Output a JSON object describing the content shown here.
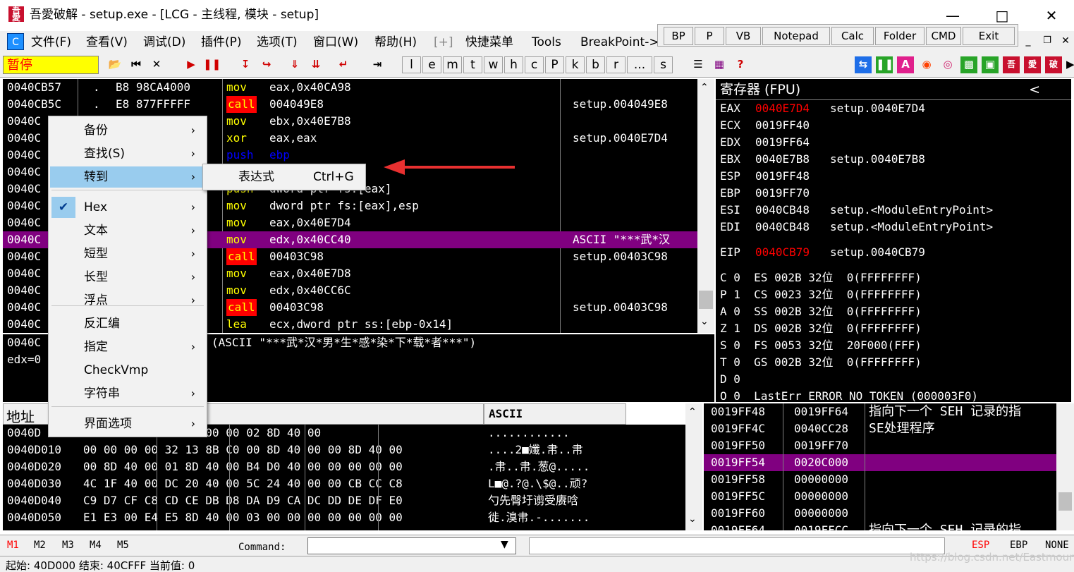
{
  "window": {
    "title": "吾愛破解 - setup.exe - [LCG -  主线程, 模块 - setup]",
    "icon_text": "吾愛"
  },
  "menu": [
    "文件(F)",
    "查看(V)",
    "调试(D)",
    "插件(P)",
    "选项(T)",
    "窗口(W)",
    "帮助(H)",
    "[+]",
    "快捷菜单",
    "Tools",
    "BreakPoint->"
  ],
  "quick_buttons": [
    "BP",
    "P",
    "VB",
    "Notepad",
    "Calc",
    "Folder",
    "CMD",
    "Exit"
  ],
  "toolbar": {
    "status": "暂停",
    "letters": [
      "l",
      "e",
      "m",
      "t",
      "w",
      "h",
      "c",
      "P",
      "k",
      "b",
      "r",
      "...",
      "s"
    ],
    "help": "?"
  },
  "disasm": {
    "rows": [
      {
        "addr": "0040CB57",
        "mark": ".",
        "hex": "B8 98CA4000",
        "mn": "mov",
        "ops": "eax,0x40CA98",
        "comment": ""
      },
      {
        "addr": "0040CB5C",
        "mark": ".",
        "hex": "E8 877FFFFF",
        "mn": "call",
        "ops": "004049E8",
        "comment": "setup.004049E8"
      },
      {
        "addr": "0040C",
        "mark": "",
        "hex": "",
        "mn": "mov",
        "ops": "ebx,0x40E7B8",
        "comment": ""
      },
      {
        "addr": "0040C",
        "mark": "",
        "hex": "",
        "mn": "xor",
        "ops": "eax,eax",
        "comment": "setup.0040E7D4"
      },
      {
        "addr": "0040C",
        "mark": "",
        "hex": "",
        "mn": "push",
        "ops": "ebp",
        "comment": ""
      },
      {
        "addr": "0040C",
        "mark": "",
        "hex": "",
        "mn": "",
        "ops": "",
        "comment": ""
      },
      {
        "addr": "0040C",
        "mark": "",
        "hex": "",
        "mn": "push",
        "ops": "dword ptr fs:[eax]",
        "comment": ""
      },
      {
        "addr": "0040C",
        "mark": "",
        "hex": "",
        "mn": "mov",
        "ops": "dword ptr fs:[eax],esp",
        "comment": ""
      },
      {
        "addr": "0040C",
        "mark": "",
        "hex": "",
        "mn": "mov",
        "ops": "eax,0x40E7D4",
        "comment": ""
      },
      {
        "addr": "0040C",
        "mark": "",
        "hex": "",
        "mn": "mov",
        "ops": "edx,0x40CC40",
        "comment": "ASCII \"***武*汉"
      },
      {
        "addr": "0040C",
        "mark": "",
        "hex": "",
        "mn": "call",
        "ops": "00403C98",
        "comment": "setup.00403C98"
      },
      {
        "addr": "0040C",
        "mark": "",
        "hex": "",
        "mn": "mov",
        "ops": "eax,0x40E7D8",
        "comment": ""
      },
      {
        "addr": "0040C",
        "mark": "",
        "hex": "",
        "mn": "mov",
        "ops": "edx,0x40CC6C",
        "comment": ""
      },
      {
        "addr": "0040C",
        "mark": "",
        "hex": "",
        "mn": "call",
        "ops": "00403C98",
        "comment": "setup.00403C98"
      },
      {
        "addr": "0040C",
        "mark": "",
        "hex": "",
        "mn": "lea",
        "ops": "ecx,dword ptr ss:[ebp-0x14]",
        "comment": ""
      }
    ],
    "info1": "0040C",
    "info2": "edx=0",
    "info_text": "(ASCII \"***武*汉*男*生*感*染*下*载*者***\")"
  },
  "registers": {
    "header": "寄存器 (FPU)",
    "collapse": "<",
    "rows": [
      {
        "name": "EAX",
        "val": "0040E7D4",
        "info": "setup.0040E7D4",
        "red": true
      },
      {
        "name": "ECX",
        "val": "0019FF40",
        "info": "",
        "red": false
      },
      {
        "name": "EDX",
        "val": "0019FF64",
        "info": "",
        "red": false
      },
      {
        "name": "EBX",
        "val": "0040E7B8",
        "info": "setup.0040E7B8",
        "red": false
      },
      {
        "name": "ESP",
        "val": "0019FF48",
        "info": "",
        "red": false
      },
      {
        "name": "EBP",
        "val": "0019FF70",
        "info": "",
        "red": false
      },
      {
        "name": "ESI",
        "val": "0040CB48",
        "info": "setup.<ModuleEntryPoint>",
        "red": false
      },
      {
        "name": "EDI",
        "val": "0040CB48",
        "info": "setup.<ModuleEntryPoint>",
        "red": false
      }
    ],
    "eip": {
      "name": "EIP",
      "val": "0040CB79",
      "info": "setup.0040CB79"
    },
    "flags": [
      "C 0  ES 002B 32位  0(FFFFFFFF)",
      "P 1  CS 0023 32位  0(FFFFFFFF)",
      "A 0  SS 002B 32位  0(FFFFFFFF)",
      "Z 1  DS 002B 32位  0(FFFFFFFF)",
      "S 0  FS 0053 32位  20F000(FFF)",
      "T 0  GS 002B 32位  0(FFFFFFFF)",
      "D 0",
      "O 0  LastErr ERROR_NO_TOKEN (000003F0)"
    ]
  },
  "dump": {
    "header_addr": "地址",
    "header_ascii": "ASCII",
    "rows": [
      {
        "addr": "0040D",
        "hex": "00 00 00 00 00 00 00 00 02 8D 40 00",
        "ascii": "............"
      },
      {
        "addr": "0040D010",
        "hex": "00 00 00 00 32 13 8B C0 00 8D 40 00 00 8D 40 00",
        "ascii": "....2■孅.帇..帇"
      },
      {
        "addr": "0040D020",
        "hex": "00 8D 40 00 01 8D 40 00 B4 D0 40 00 00 00 00 00",
        "ascii": ".帇..帇.葱@....."
      },
      {
        "addr": "0040D030",
        "hex": "4C 1F 40 00 DC 20 40 00 5C 24 40 00 00 CB CC C8",
        "ascii": "L■@.?@.\\$@..顽?"
      },
      {
        "addr": "0040D040",
        "hex": "C9 D7 CF C8 CD CE DB D8 DA D9 CA DC DD DE DF E0",
        "ascii": "勺先臀圩谫受赓唅"
      },
      {
        "addr": "0040D050",
        "hex": "E1 E3 00 E4 E5 8D 40 00 03 00 00 00 00 00 00 00",
        "ascii": "徙.溴帇.-......."
      }
    ]
  },
  "stack": {
    "rows": [
      {
        "addr": "0019FF48",
        "val": "0019FF64",
        "comment": "指向下一个 SEH 记录的指"
      },
      {
        "addr": "0019FF4C",
        "val": "0040CC28",
        "comment": "SE处理程序"
      },
      {
        "addr": "0019FF50",
        "val": "0019FF70",
        "comment": ""
      },
      {
        "addr": "0019FF54",
        "val": "0020C000",
        "comment": ""
      },
      {
        "addr": "0019FF58",
        "val": "00000000",
        "comment": ""
      },
      {
        "addr": "0019FF5C",
        "val": "00000000",
        "comment": ""
      },
      {
        "addr": "0019FF60",
        "val": "00000000",
        "comment": ""
      },
      {
        "addr": "0019FF64",
        "val": "0019FFCC",
        "comment": "指向下一个 SEH 记录的指"
      }
    ]
  },
  "context_menu": {
    "items": [
      {
        "label": "备份",
        "arrow": true,
        "checked": false
      },
      {
        "label": "查找(S)",
        "arrow": true,
        "checked": false
      },
      {
        "label": "转到",
        "arrow": true,
        "checked": false,
        "active": true
      },
      {
        "label": "Hex",
        "arrow": true,
        "checked": true
      },
      {
        "label": "文本",
        "arrow": true,
        "checked": false
      },
      {
        "label": "短型",
        "arrow": true,
        "checked": false
      },
      {
        "label": "长型",
        "arrow": true,
        "checked": false
      },
      {
        "label": "浮点",
        "arrow": true,
        "checked": false
      },
      {
        "label": "反汇编",
        "arrow": false,
        "checked": false
      },
      {
        "label": "指定",
        "arrow": true,
        "checked": false
      },
      {
        "label": "CheckVmp",
        "arrow": false,
        "checked": false
      },
      {
        "label": "字符串",
        "arrow": true,
        "checked": false
      },
      {
        "label": "界面选项",
        "arrow": true,
        "checked": false
      }
    ],
    "submenu": {
      "label": "表达式",
      "shortcut": "Ctrl+G"
    }
  },
  "cmdbar": {
    "tabs": [
      "M1",
      "M2",
      "M3",
      "M4",
      "M5"
    ],
    "command_label": "Command:",
    "command_value": "",
    "right": [
      "ESP",
      "EBP",
      "NONE"
    ]
  },
  "statusbar": {
    "text": "起始: 40D000  结束: 40CFFF  当前值: 0",
    "watermark": "https://blog.csdn.net/Eastmount"
  },
  "colors": {
    "accent_red": "#ff0000",
    "highlight_purple": "#800080",
    "pause_yellow": "#ffff00",
    "arrow_red": "#e83030"
  }
}
